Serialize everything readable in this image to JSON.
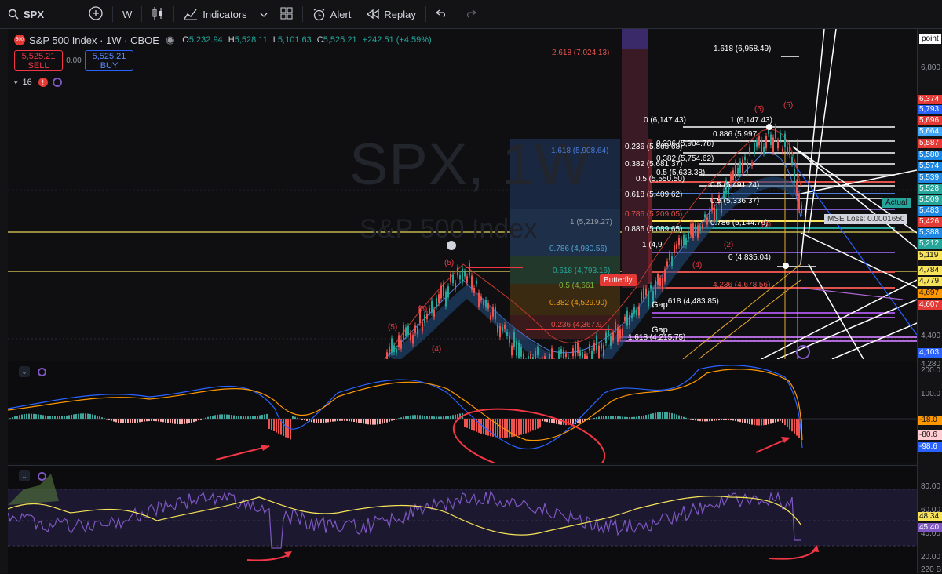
{
  "toolbar": {
    "symbol": "SPX",
    "interval": "W",
    "indicators": "Indicators",
    "alert": "Alert",
    "replay": "Replay"
  },
  "legend": {
    "title": "S&P 500 Index · 1W · CBOE",
    "badge": "500",
    "o_key": "O",
    "o_val": "5,232.94",
    "h_key": "H",
    "h_val": "5,528.11",
    "l_key": "L",
    "l_val": "5,101.63",
    "c_key": "C",
    "c_val": "5,525.21",
    "change": "+242.51 (+4.59%)"
  },
  "trade": {
    "sell_price": "5,525.21",
    "sell_label": "SELL",
    "spread": "0.00",
    "buy_price": "5,525.21",
    "buy_label": "BUY"
  },
  "indicator_count": "16",
  "watermark": {
    "symbol": "SPX, 1W",
    "name": "S&P 500 Index"
  },
  "fib_labels": [
    {
      "text": "2.618 (7,024.13)",
      "color": "#e0524b"
    },
    {
      "text": "1.618 (6,958.49)",
      "color": "#ffffff"
    },
    {
      "text": "1.618 (5,908.64)",
      "color": "#4a7bd6"
    },
    {
      "text": "0 (6,147.43)",
      "color": "#ffffff"
    },
    {
      "text": "1 (6,147.43)",
      "color": "#ffffff"
    },
    {
      "text": "0.886 (5,997",
      "color": "#ffffff"
    },
    {
      "text": "0.236 (5,865.68)",
      "color": "#ffffff"
    },
    {
      "text": "0.236 (5,904.78)",
      "color": "#ffffff"
    },
    {
      "text": "0.382 (5,681.37)",
      "color": "#ffffff"
    },
    {
      "text": "0.382 (5,754.62)",
      "color": "#ffffff"
    },
    {
      "text": "0.5 (5,550.50)",
      "color": "#ffffff"
    },
    {
      "text": "0.5 (5,633.38)",
      "color": "#ffffff"
    },
    {
      "text": "0.618 (5,409.62)",
      "color": "#ffffff"
    },
    {
      "text": "0.786 (5,209.05)",
      "color": "#e0524b"
    },
    {
      "text": "1 (5,219.27)",
      "color": "#9598a1"
    },
    {
      "text": "0.886 (5,089.65)",
      "color": "#ffffff"
    },
    {
      "text": "0.786 (4,980.56)",
      "color": "#4fa3d1"
    },
    {
      "text": "0.618 (4,793.16)",
      "color": "#26a69a"
    },
    {
      "text": "0.5 (4,661",
      "color": "#7cb342"
    },
    {
      "text": "0.382 (4,529.90)",
      "color": "#f39c12"
    },
    {
      "text": "0.236 (4,367.9",
      "color": "#e0524b"
    },
    {
      "text": "1.618 (4,215.75)",
      "color": "#ffffff"
    },
    {
      "text": "0.5 (5,491.24)",
      "color": "#ffffff"
    },
    {
      "text": "0.5 (5,336.37)",
      "color": "#ffffff"
    },
    {
      "text": "0.786 (5,144.76)",
      "color": "#ffffff"
    },
    {
      "text": "0 (4,835.04)",
      "color": "#ffffff"
    },
    {
      "text": "4.236 (4,678.56)",
      "color": "#e0524b"
    },
    {
      "text": ".618 (4,483.85)",
      "color": "#ffffff"
    },
    {
      "text": "1 (4,9",
      "color": "#ffffff"
    }
  ],
  "chart_tags": {
    "butterfly": "Butterfly",
    "gap1": "Gap",
    "gap2": "Gap",
    "actual": "Actual",
    "mse": "MSE Loss: 0.0001650",
    "point": "point"
  },
  "wave_labels": [
    "(5)",
    "(5)",
    "(5)",
    "(4)",
    "(5)",
    "(5)",
    "(3)",
    "(2)",
    "(4)"
  ],
  "price_axis": {
    "ticks": [
      "6,800",
      "4,400",
      "4,280",
      "4,103"
    ],
    "tags": [
      {
        "text": "6,374",
        "bg": "#e53935"
      },
      {
        "text": "5,793",
        "bg": "#2962ff"
      },
      {
        "text": "5,696",
        "bg": "#e53935"
      },
      {
        "text": "5,664",
        "bg": "#42a5f5"
      },
      {
        "text": "5,587",
        "bg": "#e53935"
      },
      {
        "text": "5,580",
        "bg": "#1e88e5"
      },
      {
        "text": "5,574",
        "bg": "#1e88e5"
      },
      {
        "text": "5,539",
        "bg": "#1e88e5"
      },
      {
        "text": "5,528",
        "bg": "#26a69a"
      },
      {
        "text": "5,509",
        "bg": "#26a69a"
      },
      {
        "text": "5,483",
        "bg": "#1e88e5"
      },
      {
        "text": "5,426",
        "bg": "#e53935"
      },
      {
        "text": "5,388",
        "bg": "#1e88e5"
      },
      {
        "text": "5,212",
        "bg": "#26a69a"
      },
      {
        "text": "5,119",
        "bg": "#f7e35a"
      },
      {
        "text": "4,784",
        "bg": "#f7e35a"
      },
      {
        "text": "4,779",
        "bg": "#f7e35a"
      },
      {
        "text": "4,697",
        "bg": "#ff9800"
      },
      {
        "text": "4,607",
        "bg": "#e53935"
      },
      {
        "text": "4,103",
        "bg": "#2962ff"
      }
    ]
  },
  "macd_axis": {
    "ticks": [
      "200.0",
      "100.0"
    ],
    "tags": [
      {
        "text": "-18.0",
        "bg": "#ff9800"
      },
      {
        "text": "-80.6",
        "bg": "#ffcdd2"
      },
      {
        "text": "-98.6",
        "bg": "#2962ff"
      }
    ]
  },
  "rsi_axis": {
    "ticks": [
      "80.00",
      "60.00",
      "40.00",
      "20.00",
      "220 B"
    ],
    "tags": [
      {
        "text": "48.34",
        "bg": "#f7e35a"
      },
      {
        "text": "45.40",
        "bg": "#7e57c2"
      }
    ]
  },
  "colors": {
    "up": "#26a69a",
    "down": "#ef5350",
    "macd": "#2962ff",
    "signal": "#ff9800",
    "rsi": "#7e57c2",
    "rsi_ma": "#f7e35a",
    "annotation": "#f23645"
  }
}
